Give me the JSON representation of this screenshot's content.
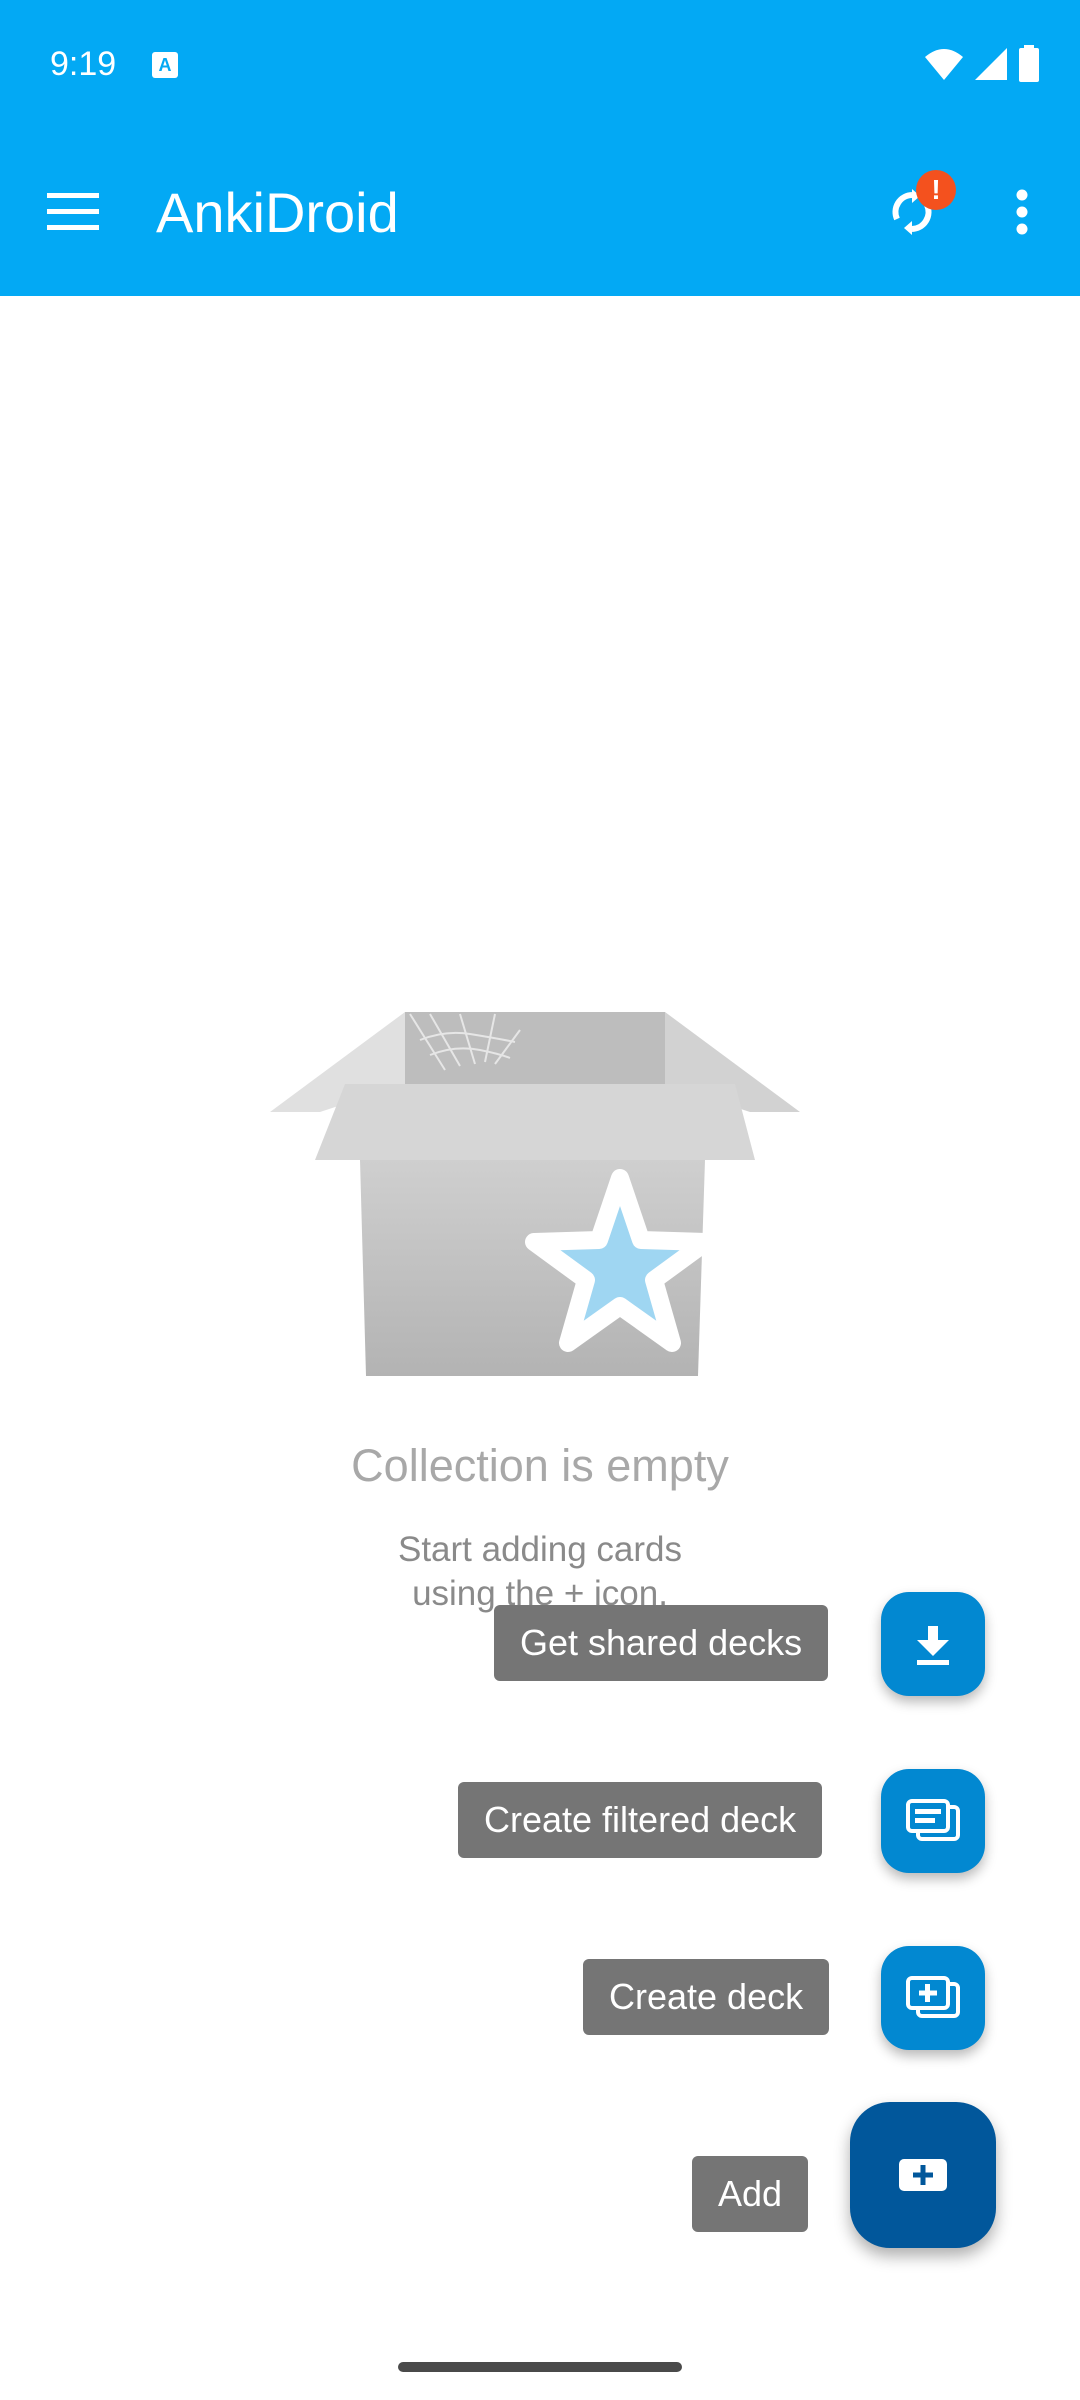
{
  "status_bar": {
    "time": "9:19",
    "notification_icon": "A"
  },
  "app_bar": {
    "title": "AnkiDroid",
    "sync_badge": "!",
    "colors": {
      "primary": "#03a9f4",
      "badge": "#f4511e"
    }
  },
  "empty_state": {
    "title": "Collection is empty",
    "subtitle_line1": "Start adding cards",
    "subtitle_line2": "using the + icon."
  },
  "speed_dial": {
    "get_shared_decks": "Get shared decks",
    "create_filtered_deck": "Create filtered deck",
    "create_deck": "Create deck",
    "add": "Add",
    "colors": {
      "mini_fab": "#0288d1",
      "main_fab": "#01579b",
      "label_bg": "#757575"
    }
  }
}
